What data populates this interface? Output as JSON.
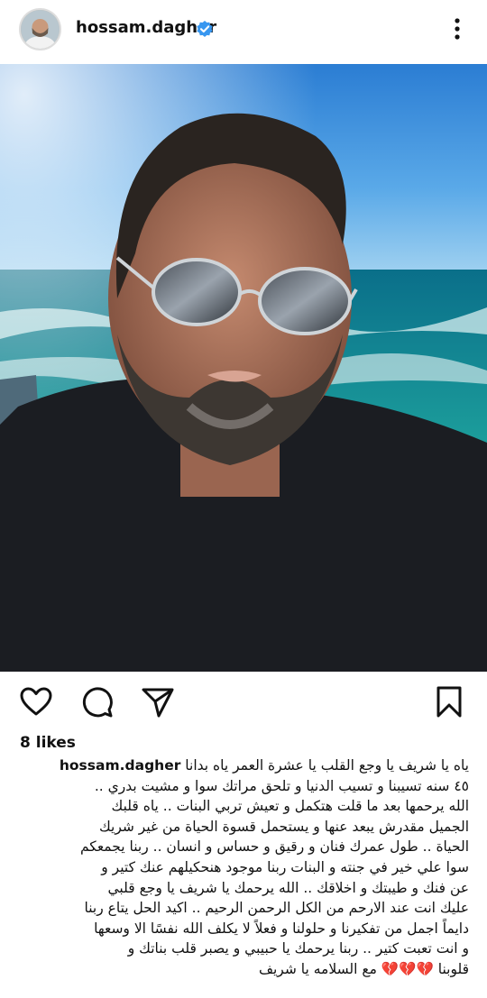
{
  "post": {
    "username": "hossam.dagher",
    "verified_icon": "verified-badge-icon",
    "more_icon": "more-vertical-icon",
    "likes": "8 likes"
  },
  "actions": {
    "like_icon": "heart-icon",
    "comment_icon": "comment-icon",
    "share_icon": "send-icon",
    "save_icon": "bookmark-icon"
  },
  "caption": {
    "username": "hossam.dagher",
    "first_line": "ياه يا شريف يا وجع القلب يا عشرة العمر ياه بدانا",
    "lines": [
      "٤٥ سنه تسيبنا و تسيب الدنيا و تلحق مراتك سوا و مشيت بدري ..",
      "الله يرحمها بعد ما قلت هتكمل و تعيش تربي البنات .. ياه قلبك",
      "الجميل مقدرش يبعد عنها و يستحمل قسوة الحياة من غير شريك",
      "الحياة .. طول عمرك فنان و رقيق و حساس و انسان .. ربنا يجمعكم",
      "سوا علي خير في جنته و البنات ربنا موجود هنحكيلهم عنك كتير و",
      "عن فنك و طيبتك و اخلاقك .. الله يرحمك يا شريف يا وجع قلبي",
      "عليك انت عند الارحم من الكل الرحمن الرحيم .. اكيد الحل يتاع ربنا",
      "دايماً اجمل من تفكيرنا و حلولنا  و فعلاً لا يكلف الله نفسًا الا وسعها",
      "و انت تعبت كتير .. ربنا يرحمك يا حبيبي و يصبر قلب بناتك و"
    ],
    "last_line": "قلوبنا",
    "hearts": "💔💔💔",
    "closing": "مع السلامه يا شريف"
  },
  "colors": {
    "verified_blue": "#3897f0",
    "heart_red": "#e4003a",
    "text": "#111111"
  }
}
